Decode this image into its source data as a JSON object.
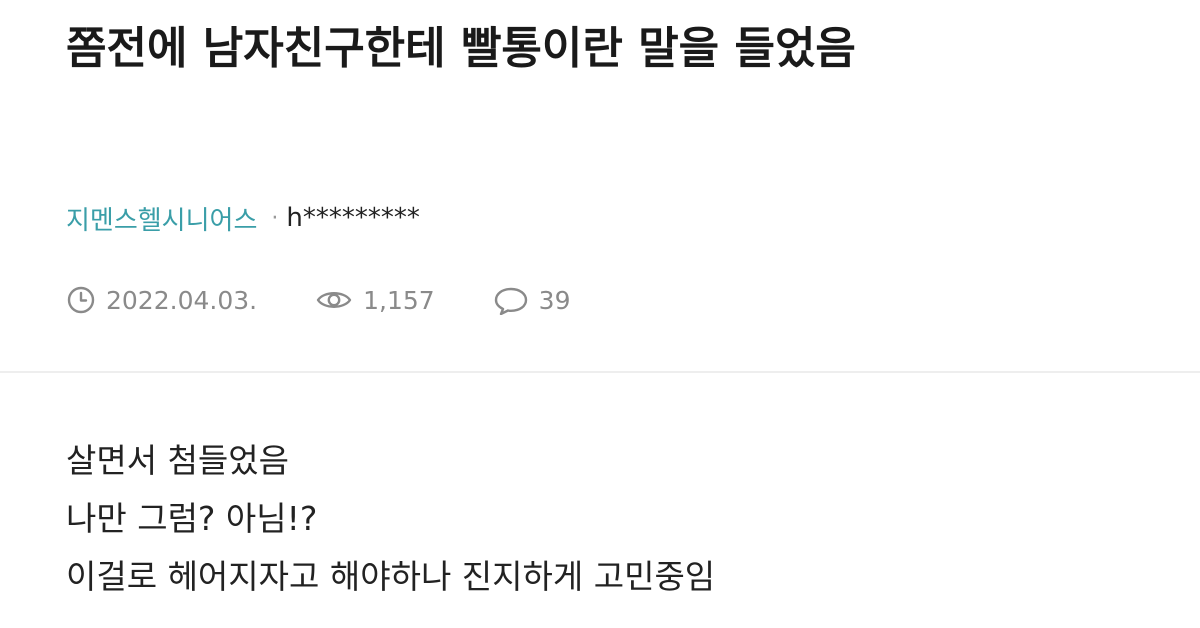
{
  "post": {
    "title": "쫌전에 남자친구한테 빨통이란 말을 들었음",
    "board": "지멘스헬시니어스",
    "separator": "·",
    "author": "h*********",
    "date": "2022.04.03.",
    "views": "1,157",
    "comments": "39",
    "body_lines": [
      "살면서 첨들었음",
      "나만 그럼? 아님!?",
      "이걸로 헤어지자고 해야하나 진지하게 고민중임"
    ]
  },
  "icons": {
    "date": "clock-icon",
    "views": "eye-icon",
    "comments": "speech-bubble-icon"
  },
  "colors": {
    "board_link": "#3a9ea8",
    "meta_text": "#8a8a8a",
    "title_text": "#1a1a1a",
    "divider": "#eeeeee"
  }
}
